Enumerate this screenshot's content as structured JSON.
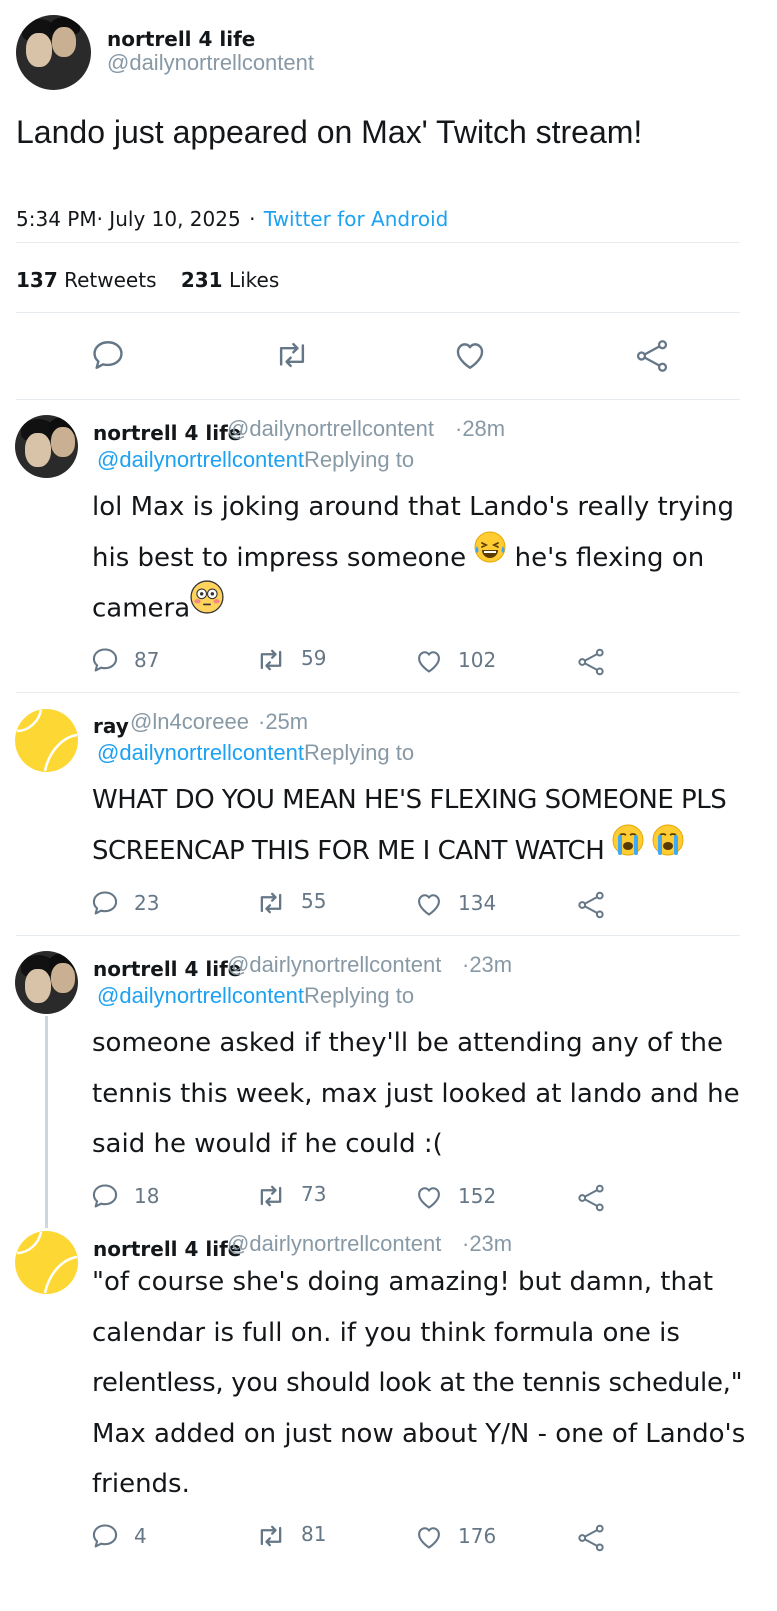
{
  "main_tweet": {
    "author_name": "nortrell 4 life",
    "author_handle": "@dailynortrellcontent",
    "text": "Lando just appeared on Max' Twitch stream!",
    "time": "5:34 PM",
    "date": "· July 10, 2025",
    "via_sep": "·",
    "source": "Twitter for Android",
    "retweets_count": "137",
    "retweets_label": "Retweets",
    "likes_count": "231",
    "likes_label": "Likes"
  },
  "replies": [
    {
      "author_name": "nortrell 4 life",
      "author_handle": "@dailynortrellcontent",
      "time": "·28m",
      "replying_to_handle": "@dailynortrellcontent",
      "replying_to_label": "Replying to",
      "text_lines": [
        "lol Max is joking around that Lando's really trying",
        "his best to impress someone",
        " he's flexing on",
        "camera"
      ],
      "emoji": [
        "grinning-squinting-face-with-tears",
        "flushed-face"
      ],
      "reply_count": "87",
      "retweet_count": "59",
      "like_count": "102"
    },
    {
      "author_name": "ray",
      "author_handle": "@ln4coreee",
      "time": "·25m",
      "replying_to_handle": "@dailynortrellcontent",
      "replying_to_label": "Replying to",
      "text_lines": [
        "WHAT DO YOU MEAN HE'S FLEXING SOMEONE PLS",
        "SCREENCAP THIS FOR ME I CANT WATCH"
      ],
      "emoji": [
        "loudly-crying-face",
        "loudly-crying-face"
      ],
      "reply_count": "23",
      "retweet_count": "55",
      "like_count": "134"
    },
    {
      "author_name": "nortrell 4 life",
      "author_handle": "@dairlynortrellcontent",
      "time": "·23m",
      "replying_to_handle": "@dailynortrellcontent",
      "replying_to_label": "Replying to",
      "text_lines": [
        "someone asked if they'll be attending any of the",
        "tennis this week, max just looked at lando and he",
        "said he would if he could :("
      ],
      "reply_count": "18",
      "retweet_count": "73",
      "like_count": "152"
    },
    {
      "author_name": "nortrell 4 life",
      "author_handle": "@dairlynortrellcontent",
      "time": "·23m",
      "text_lines": [
        "\"of course she's doing amazing! but damn, that",
        "calendar is full on. if you think formula one is",
        "relentless, you should look at the tennis schedule,\"",
        "Max added on just now about Y/N - one of Lando's",
        "friends."
      ],
      "reply_count": "4",
      "retweet_count": "81",
      "like_count": "176"
    }
  ],
  "icons": {
    "reply": "speech-bubble-icon",
    "retweet": "retweet-arrows-icon",
    "like": "heart-outline-icon",
    "share": "share-nodes-icon"
  },
  "colors": {
    "link": "#1da1f2",
    "muted": "#8899a6",
    "icon": "#657786",
    "divider": "#e6ecf0",
    "tennis_ball": "#fdd835"
  }
}
